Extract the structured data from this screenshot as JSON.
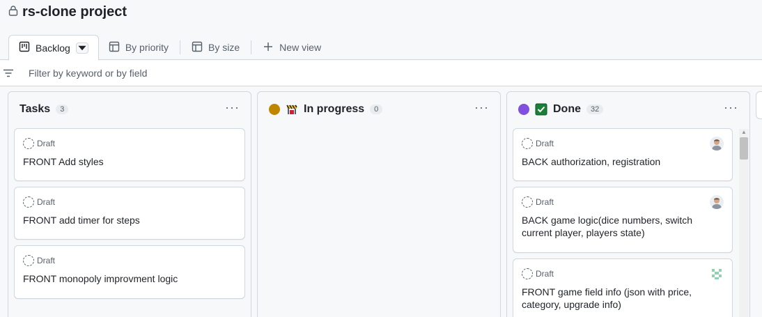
{
  "project": {
    "title": "rs-clone project"
  },
  "tabs": [
    {
      "label": "Backlog"
    },
    {
      "label": "By priority"
    },
    {
      "label": "By size"
    },
    {
      "label": "New view"
    }
  ],
  "filter": {
    "placeholder": "Filter by keyword or by field"
  },
  "columns": [
    {
      "title": "Tasks",
      "count": "3",
      "cards": [
        {
          "status": "Draft",
          "title": "FRONT Add styles"
        },
        {
          "status": "Draft",
          "title": "FRONT add timer for steps"
        },
        {
          "status": "Draft",
          "title": "FRONT monopoly improvment logic"
        }
      ]
    },
    {
      "title": "In progress",
      "count": "0",
      "dot_color": "#bf8700",
      "emoji": "construction-icon",
      "cards": []
    },
    {
      "title": "Done",
      "count": "32",
      "dot_color": "#8250df",
      "emoji": "check-mark-button-icon",
      "cards": [
        {
          "status": "Draft",
          "title": "BACK authorization, registration"
        },
        {
          "status": "Draft",
          "title": "BACK game logic(dice numbers, switch current player, players state)"
        },
        {
          "status": "Draft",
          "title": "FRONT game field info (json with price, category, upgrade info)"
        }
      ]
    }
  ]
}
